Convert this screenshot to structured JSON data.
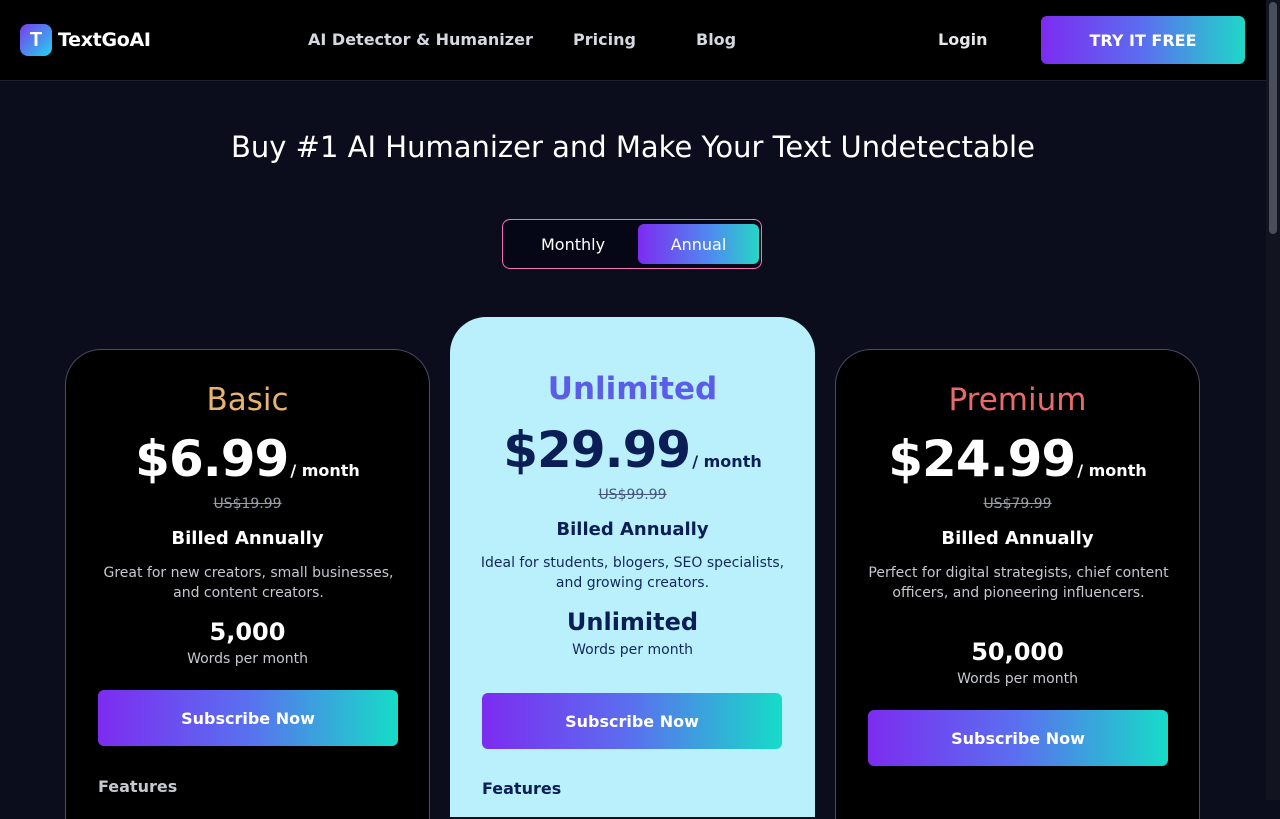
{
  "nav": {
    "brand": "TextGoAI",
    "brand_initial": "T",
    "links": [
      "AI Detector & Humanizer",
      "Pricing",
      "Blog"
    ],
    "login": "Login",
    "cta": "TRY IT FREE"
  },
  "headline": "Buy #1 AI Humanizer and Make Your Text Undetectable",
  "billing_toggle": {
    "options": [
      "Monthly",
      "Annual"
    ],
    "selected": "Annual"
  },
  "plans": [
    {
      "name": "Basic",
      "name_color": "#e8b36e",
      "price": "$6.99",
      "per": "/ month",
      "old_price": "US$19.99",
      "billed": "Billed Annually",
      "description": "Great for new creators, small businesses, and content creators.",
      "words": "5,000",
      "words_label": "Words per month",
      "button": "Subscribe Now",
      "features_label": "Features"
    },
    {
      "name": "Unlimited",
      "name_color": "#5b5de8",
      "price": "$29.99",
      "per": "/ month",
      "old_price": "US$99.99",
      "billed": "Billed Annually",
      "description": "Ideal for students, blogers, SEO specialists, and growing creators.",
      "words": "Unlimited",
      "words_label": "Words per month",
      "button": "Subscribe Now",
      "features_label": "Features"
    },
    {
      "name": "Premium",
      "name_color": "#e86a6a",
      "price": "$24.99",
      "per": "/ month",
      "old_price": "US$79.99",
      "billed": "Billed Annually",
      "description": "Perfect for digital strategists, chief content officers, and pioneering influencers.",
      "words": "50,000",
      "words_label": "Words per month",
      "button": "Subscribe Now"
    }
  ],
  "colors": {
    "accent_gradient_start": "#7c2cf0",
    "accent_gradient_end": "#16dcc8",
    "featured_card_bg": "#b9f0fb",
    "toggle_border": "#f472b6"
  }
}
